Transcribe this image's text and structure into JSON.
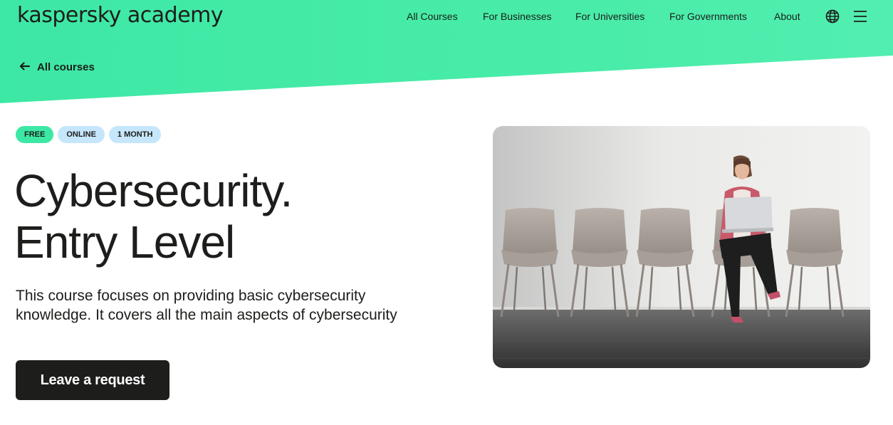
{
  "header": {
    "logo": "kaspersky academy",
    "nav": [
      "All Courses",
      "For Businesses",
      "For Universities",
      "For Governments",
      "About"
    ],
    "icons": [
      "globe-icon",
      "menu-icon"
    ]
  },
  "breadcrumb": {
    "back_label": "All courses",
    "icon": "arrow-left-icon"
  },
  "badges": [
    "FREE",
    "ONLINE",
    "1 MONTH"
  ],
  "course": {
    "title_line1": "Cybersecurity.",
    "title_line2": "Entry Level",
    "description": "This course focuses on providing basic cybersecurity knowledge. It covers all the main aspects of cybersecurity",
    "cta_label": "Leave a request"
  },
  "colors": {
    "accent": "#3de8a4",
    "badge_blue": "#c5e6fb",
    "dark": "#1d1d1b"
  }
}
